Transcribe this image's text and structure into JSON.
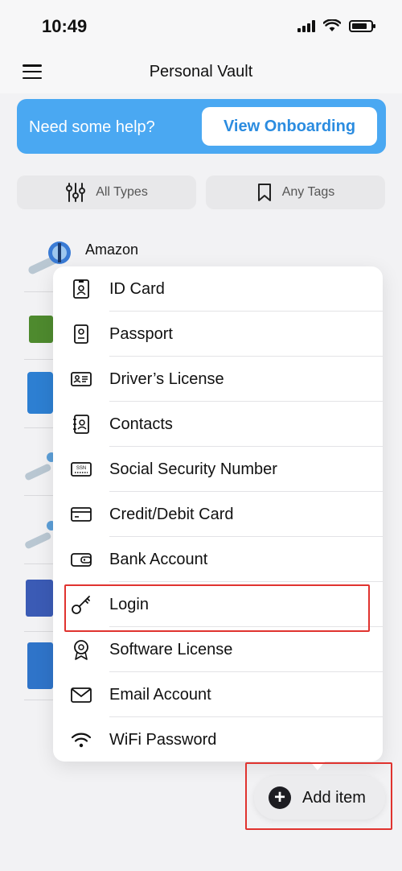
{
  "status": {
    "time": "10:49"
  },
  "header": {
    "title": "Personal Vault"
  },
  "banner": {
    "text": "Need some help?",
    "button": "View Onboarding"
  },
  "filters": {
    "types": "All Types",
    "tags": "Any Tags"
  },
  "list": {
    "first_item": "Amazon"
  },
  "menu": {
    "items": [
      {
        "label": "ID Card",
        "icon": "id-card-icon"
      },
      {
        "label": "Passport",
        "icon": "passport-icon"
      },
      {
        "label": "Driver’s License",
        "icon": "drivers-license-icon"
      },
      {
        "label": "Contacts",
        "icon": "contacts-icon"
      },
      {
        "label": "Social Security Number",
        "icon": "ssn-icon"
      },
      {
        "label": "Credit/Debit Card",
        "icon": "credit-card-icon"
      },
      {
        "label": "Bank Account",
        "icon": "bank-account-icon"
      },
      {
        "label": "Login",
        "icon": "key-icon"
      },
      {
        "label": "Software License",
        "icon": "software-license-icon"
      },
      {
        "label": "Email Account",
        "icon": "email-icon"
      },
      {
        "label": "WiFi Password",
        "icon": "wifi-icon"
      }
    ]
  },
  "add_button": {
    "label": "Add item"
  },
  "colors": {
    "accent": "#4aa8f2",
    "highlight": "#e0332f"
  }
}
